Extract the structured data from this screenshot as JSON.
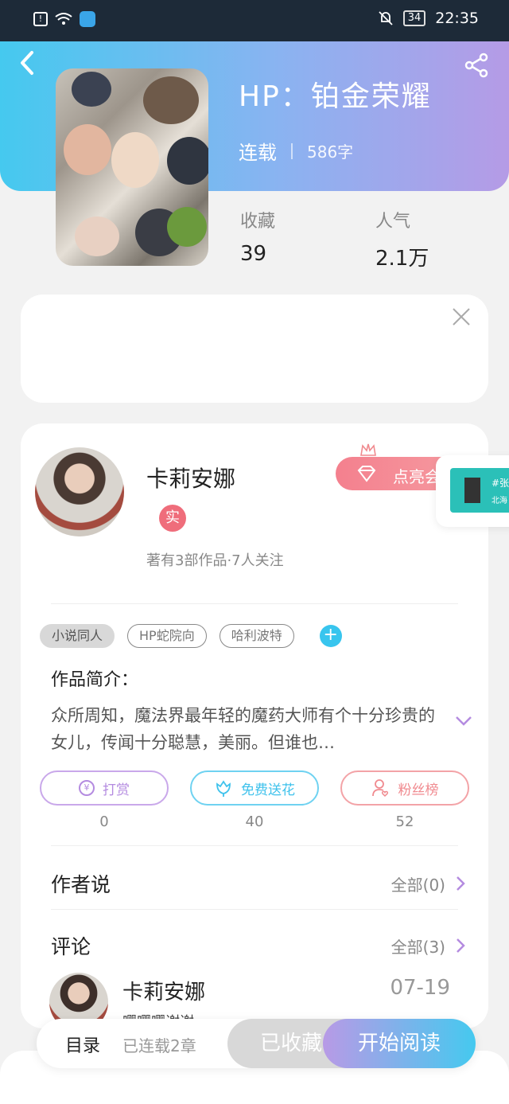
{
  "status_bar": {
    "time": "22:35",
    "battery": "34"
  },
  "book": {
    "title": "HP：铂金荣耀",
    "status": "连载",
    "word_count": "586字",
    "stats": [
      {
        "label": "收藏",
        "value": "39"
      },
      {
        "label": "人气",
        "value": "2.1万"
      }
    ]
  },
  "author": {
    "name": "卡莉安娜",
    "verified_badge": "实",
    "meta": "著有3部作品·7人关注",
    "light_button": "点亮会"
  },
  "tags": [
    "小说同人",
    "HP蛇院向",
    "哈利波特"
  ],
  "tag_add": "+",
  "intro": {
    "title": "作品简介：",
    "text": "众所周知，魔法界最年轻的魔药大师有个十分珍贵的女儿，传闻十分聪慧，美丽。但谁也…"
  },
  "actions": [
    {
      "label": "打赏",
      "count": "0",
      "color": "#b48be0"
    },
    {
      "label": "免费送花",
      "count": "40",
      "color": "#3fc2ec"
    },
    {
      "label": "粉丝榜",
      "count": "52",
      "color": "#f08a8f"
    }
  ],
  "author_says": {
    "label": "作者说",
    "all": "全部(0)"
  },
  "comments": {
    "label": "评论",
    "all": "全部(3)",
    "first": {
      "user": "卡莉安娜",
      "date": "07-19",
      "text": "嘤嘤嘤谢谢"
    }
  },
  "float_card": {
    "line1": "#张",
    "line2": "北海"
  },
  "bottom_bar": {
    "toc": "目录",
    "chapters": "已连载2章",
    "collected": "已收藏",
    "read": "开始阅读"
  },
  "colors": {
    "accent_cyan": "#45c9ef",
    "accent_purple": "#b59be6",
    "pink": "#ef6d7b"
  }
}
